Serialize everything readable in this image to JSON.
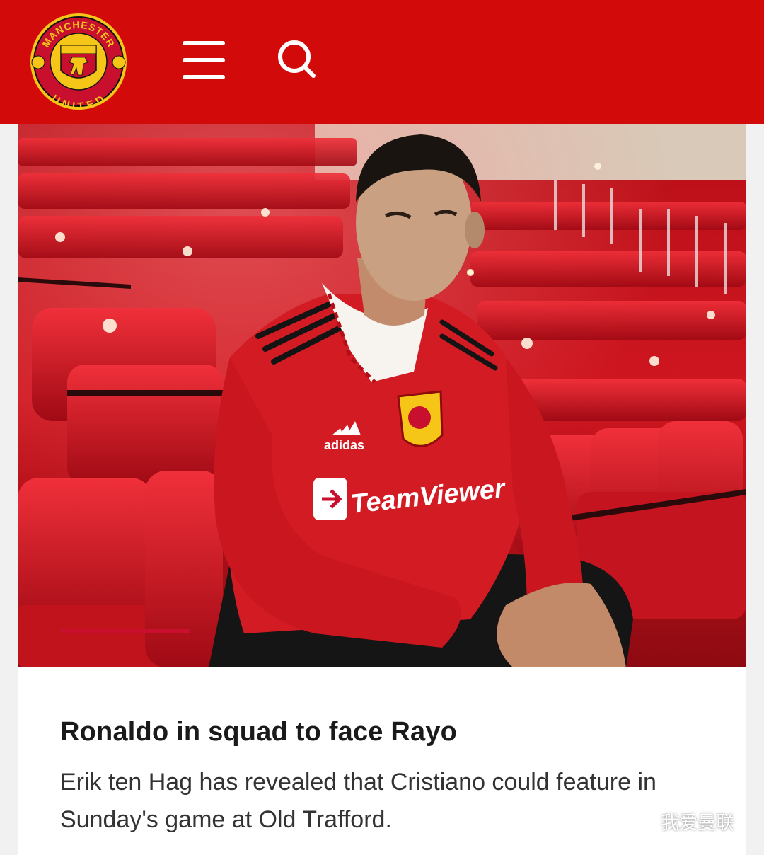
{
  "header": {
    "brand": "Manchester United",
    "crest_top_text": "MANCHESTER",
    "crest_bottom_text": "UNITED",
    "icons": {
      "menu": "hamburger-menu-icon",
      "search": "search-icon"
    },
    "colors": {
      "brand_red": "#d20a0a",
      "crest_gold": "#f5c518"
    }
  },
  "article": {
    "image": {
      "jersey_brand": "adidas",
      "jersey_sponsor": "TeamViewer",
      "carousel_progress": 1.0
    },
    "headline": "Ronaldo in squad to face Rayo",
    "summary": "Erik ten Hag has revealed that Cristiano could feature in Sunday's game at Old Trafford."
  },
  "watermark": {
    "text": "我爱曼联",
    "icon": "wechat-icon"
  }
}
